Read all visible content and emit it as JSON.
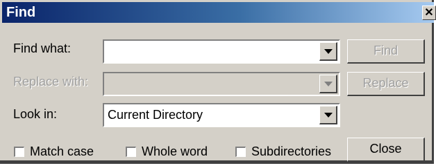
{
  "window": {
    "title": "Find",
    "close_glyph": "✕"
  },
  "fields": {
    "find_what": {
      "label": "Find what:",
      "value": ""
    },
    "replace_with": {
      "label": "Replace with:",
      "value": "",
      "disabled": true
    },
    "look_in": {
      "label": "Look in:",
      "value": "Current Directory"
    }
  },
  "buttons": {
    "find": {
      "label": "Find",
      "disabled": true
    },
    "replace": {
      "label": "Replace",
      "disabled": true
    },
    "close": {
      "label": "Close",
      "disabled": false
    }
  },
  "options": {
    "match_case": {
      "label": "Match case",
      "checked": false
    },
    "whole_word": {
      "label": "Whole word",
      "checked": false
    },
    "subdirectories": {
      "label": "Subdirectories",
      "checked": false
    }
  },
  "icons": {
    "combo_arrow": "chevron-down-icon",
    "title_close": "close-icon"
  },
  "colors": {
    "titlebar_start": "#0a246a",
    "titlebar_end": "#a6caf0",
    "face": "#d4d0c8",
    "disabled_text": "#a0a0a0"
  }
}
